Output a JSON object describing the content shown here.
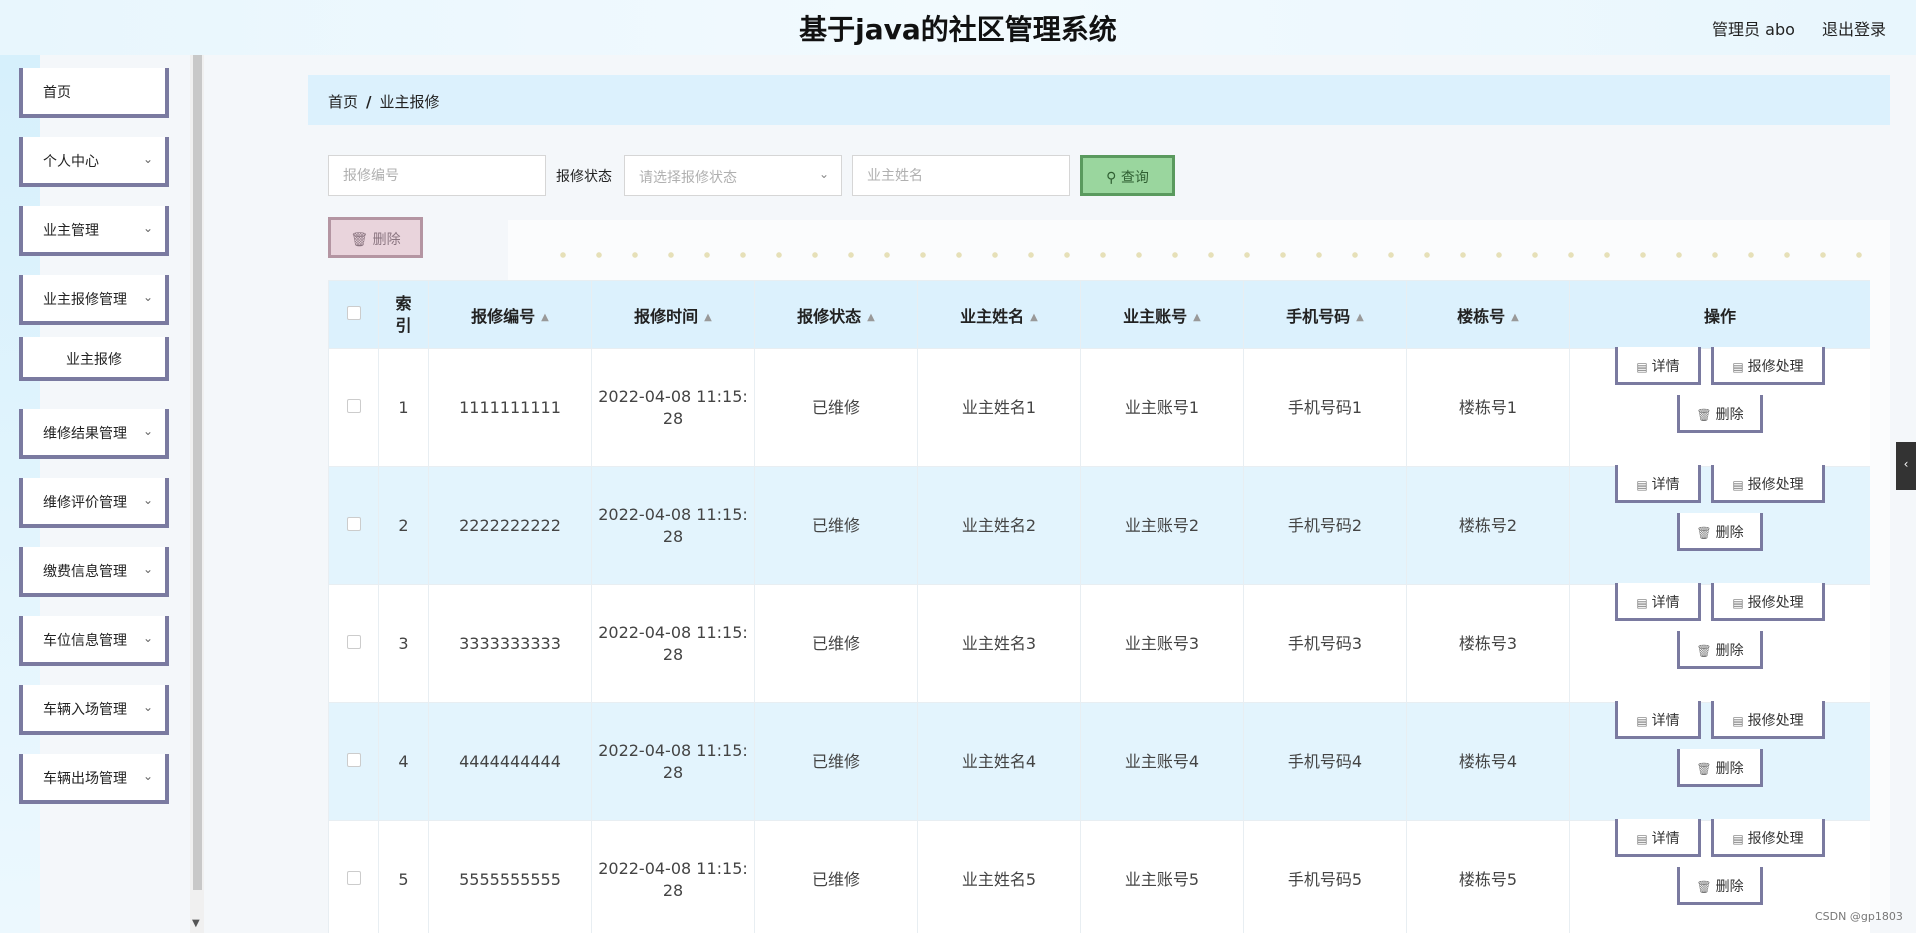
{
  "header": {
    "title": "基于java的社区管理系统",
    "user": "管理员 abo",
    "logout": "退出登录"
  },
  "sidebar": {
    "items": [
      {
        "label": "首页",
        "has_chevron": false
      },
      {
        "label": "个人中心",
        "has_chevron": true
      },
      {
        "label": "业主管理",
        "has_chevron": true
      },
      {
        "label": "业主报修管理",
        "has_chevron": true
      },
      {
        "label": "维修结果管理",
        "has_chevron": true
      },
      {
        "label": "维修评价管理",
        "has_chevron": true
      },
      {
        "label": "缴费信息管理",
        "has_chevron": true
      },
      {
        "label": "车位信息管理",
        "has_chevron": true
      },
      {
        "label": "车辆入场管理",
        "has_chevron": true
      },
      {
        "label": "车辆出场管理",
        "has_chevron": true
      }
    ],
    "submenu": "业主报修"
  },
  "breadcrumb": {
    "home": "首页",
    "separator": "/",
    "current": "业主报修"
  },
  "search": {
    "repair_no_placeholder": "报修编号",
    "status_label": "报修状态",
    "status_placeholder": "请选择报修状态",
    "owner_name_placeholder": "业主姓名",
    "query_label": "查询"
  },
  "toolbar": {
    "delete_label": "删除"
  },
  "table": {
    "headers": {
      "index": "索引",
      "repair_no": "报修编号",
      "repair_time": "报修时间",
      "repair_status": "报修状态",
      "owner_name": "业主姓名",
      "owner_account": "业主账号",
      "phone": "手机号码",
      "building": "楼栋号",
      "actions": "操作"
    },
    "rows": [
      {
        "index": "1",
        "repair_no": "1111111111",
        "time_a": "2022-04-08 11:15:",
        "time_b": "28",
        "status": "已维修",
        "owner_name": "业主姓名1",
        "owner_account": "业主账号1",
        "phone": "手机号码1",
        "building": "楼栋号1"
      },
      {
        "index": "2",
        "repair_no": "2222222222",
        "time_a": "2022-04-08 11:15:",
        "time_b": "28",
        "status": "已维修",
        "owner_name": "业主姓名2",
        "owner_account": "业主账号2",
        "phone": "手机号码2",
        "building": "楼栋号2"
      },
      {
        "index": "3",
        "repair_no": "3333333333",
        "time_a": "2022-04-08 11:15:",
        "time_b": "28",
        "status": "已维修",
        "owner_name": "业主姓名3",
        "owner_account": "业主账号3",
        "phone": "手机号码3",
        "building": "楼栋号3"
      },
      {
        "index": "4",
        "repair_no": "4444444444",
        "time_a": "2022-04-08 11:15:",
        "time_b": "28",
        "status": "已维修",
        "owner_name": "业主姓名4",
        "owner_account": "业主账号4",
        "phone": "手机号码4",
        "building": "楼栋号4"
      },
      {
        "index": "5",
        "repair_no": "5555555555",
        "time_a": "2022-04-08 11:15:",
        "time_b": "28",
        "status": "已维修",
        "owner_name": "业主姓名5",
        "owner_account": "业主账号5",
        "phone": "手机号码5",
        "building": "楼栋号5"
      }
    ],
    "actions": {
      "detail": "详情",
      "handle": "报修处理",
      "delete": "删除"
    }
  },
  "footer": {
    "watermark": "CSDN @gp1803"
  },
  "colors": {
    "header_bg": "#e8f6fd",
    "breadcrumb_bg": "#dcf1fd",
    "row_alt_bg": "#e3f4fd",
    "menu_border": "#7a7aa0",
    "query_button": "#9ad69e",
    "delete_button": "#e9d4dc"
  },
  "icons": {
    "chevron": "chevron-down-icon",
    "search": "search-icon",
    "trash": "trash-icon",
    "document": "document-icon",
    "sort": "sort-caret-icon",
    "collapse": "chevron-left-icon"
  }
}
